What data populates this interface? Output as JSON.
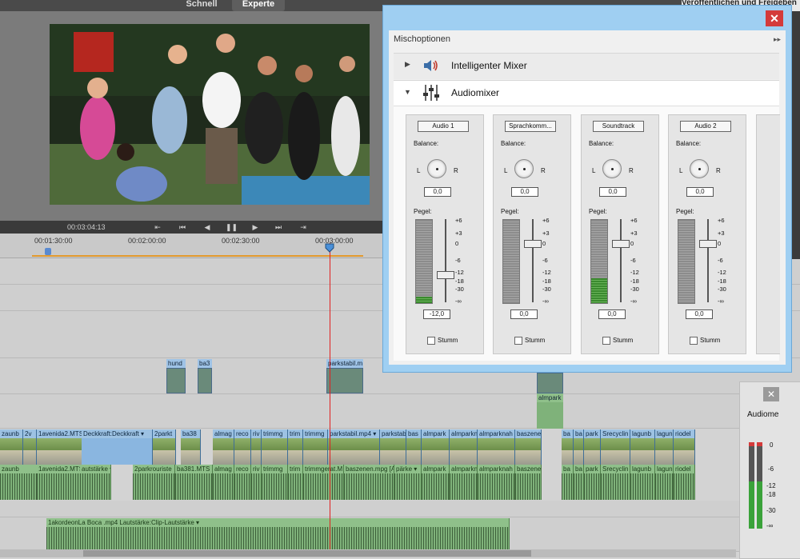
{
  "top_bar": {
    "mode_tabs": [
      "Schnell",
      "Experte"
    ],
    "active_mode": "Experte",
    "publish_label": "Veröffentlichen und Freigeben"
  },
  "monitor": {
    "timecode": "00:03:04:13",
    "transport_icons": [
      "go-to-start-icon",
      "previous-edit-icon",
      "step-back-icon",
      "pause-icon",
      "step-forward-icon",
      "next-edit-icon",
      "go-to-end-icon"
    ]
  },
  "ruler": {
    "labels": [
      "00:01:30:00",
      "00:02:00:00",
      "00:02:30:00",
      "00:03:00:00"
    ]
  },
  "timeline": {
    "title_clips": [
      "hund",
      "ba3",
      "parkstabil.m",
      "almpark"
    ],
    "video_clips": [
      "zaunb",
      "2v",
      "1avenida2.MTS",
      "Deckkraft:Deckkraft ▾",
      "2parkt",
      "ba38",
      "almag",
      "reco",
      "riv",
      "trimmg",
      "trim",
      "trimmg",
      "parkstabil.mp4 ▾",
      "parkstab",
      "bas",
      "almpark",
      "almparkn",
      "almparknah",
      "baszene",
      "ba",
      "ba",
      "park",
      "Srecyclin",
      "lagunb",
      "lagun",
      "riodel"
    ],
    "audio_clips": [
      "zaunb",
      "1avenida2.MTS",
      "autstärke ▾",
      "2parkrouriste",
      "ba381.MTS [",
      "almag",
      "reco",
      "riv",
      "trimmg",
      "trim",
      "trimmgerat.M",
      "baszenen.mpg [A]",
      "pärke ▾",
      "almpark",
      "almparkn",
      "almparknah",
      "baszene",
      "ba",
      "ba",
      "park",
      "Srecyclin",
      "lagunb",
      "lagun",
      "riodel"
    ],
    "music_clip": "1akordeonLa Boca .mp4  Lautstärke:Clip-Lautstärke ▾"
  },
  "mixer": {
    "title": "Mischoptionen",
    "close": "✕",
    "sections": [
      {
        "label": "Intelligenter Mixer",
        "icon": "speaker-icon",
        "expanded": false
      },
      {
        "label": "Audiomixer",
        "icon": "mixer-sliders-icon",
        "expanded": true
      }
    ],
    "balance_label": "Balance:",
    "pegel_label": "Pegel:",
    "left_letter": "L",
    "right_letter": "R",
    "mute_label": "Stumm",
    "scale_marks": [
      "+6",
      "+3",
      "0",
      "-6",
      "-12",
      "-18",
      "-30",
      "-∞"
    ],
    "channels": [
      {
        "name": "Audio 1",
        "balance": "0,0",
        "level": "-12,0",
        "meter_fill": 0.08
      },
      {
        "name": "Sprachkomm...",
        "balance": "0,0",
        "level": "0,0",
        "meter_fill": 0
      },
      {
        "name": "Soundtrack",
        "balance": "0,0",
        "level": "0,0",
        "meter_fill": 0.3
      },
      {
        "name": "Audio 2",
        "balance": "0,0",
        "level": "0,0",
        "meter_fill": 0
      }
    ]
  },
  "audio_meter_panel": {
    "label": "Audiome",
    "close": "✕",
    "scale": [
      "0",
      "-6",
      "-12",
      "-18",
      "-30",
      "-∞"
    ],
    "level_left": 0.55,
    "level_right": 0.55
  },
  "colors": {
    "dialog_border": "#9fcff2",
    "close_red": "#d43a3a",
    "playhead": "#e02020",
    "video_clip": "#6f9ec8",
    "audio_clip": "#7fb27a"
  }
}
